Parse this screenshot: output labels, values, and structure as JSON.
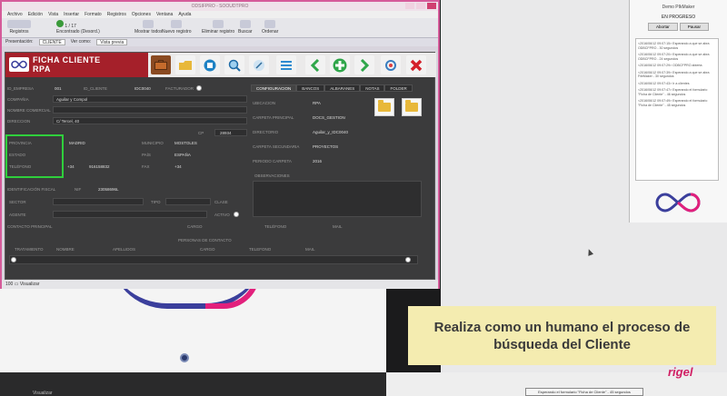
{
  "window": {
    "title": "ODSIFPRO - SOOUDTPRO",
    "menu": [
      "Archivo",
      "Edición",
      "Vista",
      "Insertar",
      "Formato",
      "Registros",
      "Opciones",
      "Ventana",
      "Ayuda"
    ],
    "ribbon": {
      "registros": "Registros",
      "record_info": "1 / 17",
      "record_sub": "Encontrado (Desord.)",
      "mostrar_todos": "Mostrar todos",
      "nuevo_registro": "Nuevo registro",
      "eliminar_registro": "Eliminar registro",
      "buscar": "Buscar",
      "ordenar": "Ordenar"
    },
    "toolbar2": {
      "presentacion_label": "Presentación:",
      "presentacion_value": "CLIENTE",
      "ver_como": "Ver como:",
      "vista_previa": "Vista previa"
    },
    "statusbar": "100   ▭   Visualizar"
  },
  "form": {
    "title_line1": "FICHA CLIENTE",
    "title_line2": "RPA",
    "colors": {
      "header_red": "#a5202a",
      "highlight": "#2fcf3c"
    },
    "fields": {
      "id_empresa_label": "ID_EMPRESA",
      "id_empresa_value": "001",
      "id_cliente_label": "ID_CLIENTE",
      "id_cliente_value": "IDC0040",
      "facturador_label": "FACTURADOR",
      "compania_label": "COMPAÑIA",
      "compania_value": "Aguilar y Compol",
      "nombre_comercial_label": "NOMBRE COMERCIAL",
      "direccion_label": "DIRECCION",
      "direccion_value": "C/ Tercel, 40",
      "cp_label": "CP",
      "cp_value": "28934",
      "provincia_label": "PROVINCIA",
      "provincia_value": "MADRID",
      "municipio_label": "MUNICIPIO",
      "municipio_value": "MOSTOLES",
      "estado_label": "ESTADO",
      "pais_label": "PAÍS",
      "pais_value": "ESPAÑA",
      "telefono_label": "TELÉFONO",
      "telefono_prefix": "+34",
      "telefono_value": "916158832",
      "fax_label": "FAX",
      "fax_prefix": "+34",
      "identificacion_label": "IDENTIFICACIÓN FISCAL",
      "nif_label": "NIF",
      "nif_value": "23058696L",
      "sector_label": "SECTOR",
      "tipo_label": "TIPO",
      "clase_label": "CLASE",
      "agente_label": "AGENTE",
      "activo_label": "ACTIVO",
      "contacto_label": "CONTACTO PRINCIPAL",
      "cargo_label": "CARGO",
      "telefono2_label": "TELÉFONO",
      "mail_label": "MAIL"
    },
    "tabs": [
      "CONFIGURACION",
      "BANCOS",
      "ALBARANES",
      "NOTAS",
      "FOLDER"
    ],
    "config": {
      "ubicacion_label": "UBICACION",
      "ubicacion_value": "RPA",
      "carpeta_principal_label": "CARPETA PRINCIPAL",
      "carpeta_principal_value": "DOCS_GESTION",
      "directorio_label": "DIRECTORIO",
      "directorio_value": "Aguilar_y_IDC0040",
      "carpeta_secundaria_label": "CARPETA SECUNDARIA",
      "carpeta_secundaria_value": "PROYECTOS",
      "periodo_label": "PERIODO CARPETA",
      "periodo_value": "2016",
      "observaciones_label": "OBSERVACIONES"
    },
    "contacts": {
      "heading": "PERSONAS DE CONTACTO",
      "columns": [
        "TRATAMIENTO",
        "NOMBRE",
        "APELLIDOS",
        "CARGO",
        "TELEFONO",
        "MAIL"
      ]
    }
  },
  "side_panel": {
    "title": "Demo PIkMaker",
    "status": "EN PROGRESO",
    "buttons": [
      "Abortar",
      "Pausar"
    ],
    "log": [
      "<2016/06/12 09:07:15> Esperando a que se abra ODBCFPRO - 30 segundos",
      "<2016/06/12 09:07:20> Esperando a que se abra ODBCFPRO - 24 segundos",
      "<2016/06/12 09:07:29> ODBCFPRO abierta",
      "<2016/06/12 09:07:39> Esperando a que se abra FileMaker - 30 segundos",
      "<2016/06/12 09:07:43> Ir a clientes",
      "<2016/06/12 09:07:47> Esperando el formulario \"Ficha de Cliente\" - 46 segundos",
      "<2016/06/12 09:07:49> Esperando el formulario \"Ficha de Cliente\" - 45 segundos"
    ]
  },
  "banner": {
    "line1": "Realiza como un humano el proceso de",
    "line2": "búsqueda del Cliente",
    "bg": "#f4ecb0"
  },
  "brand": "rigel",
  "tooltip": "Esperando el formulario \"Ficha de Cliente\" - 45 segundos",
  "taskbar_label": "Visualizar"
}
